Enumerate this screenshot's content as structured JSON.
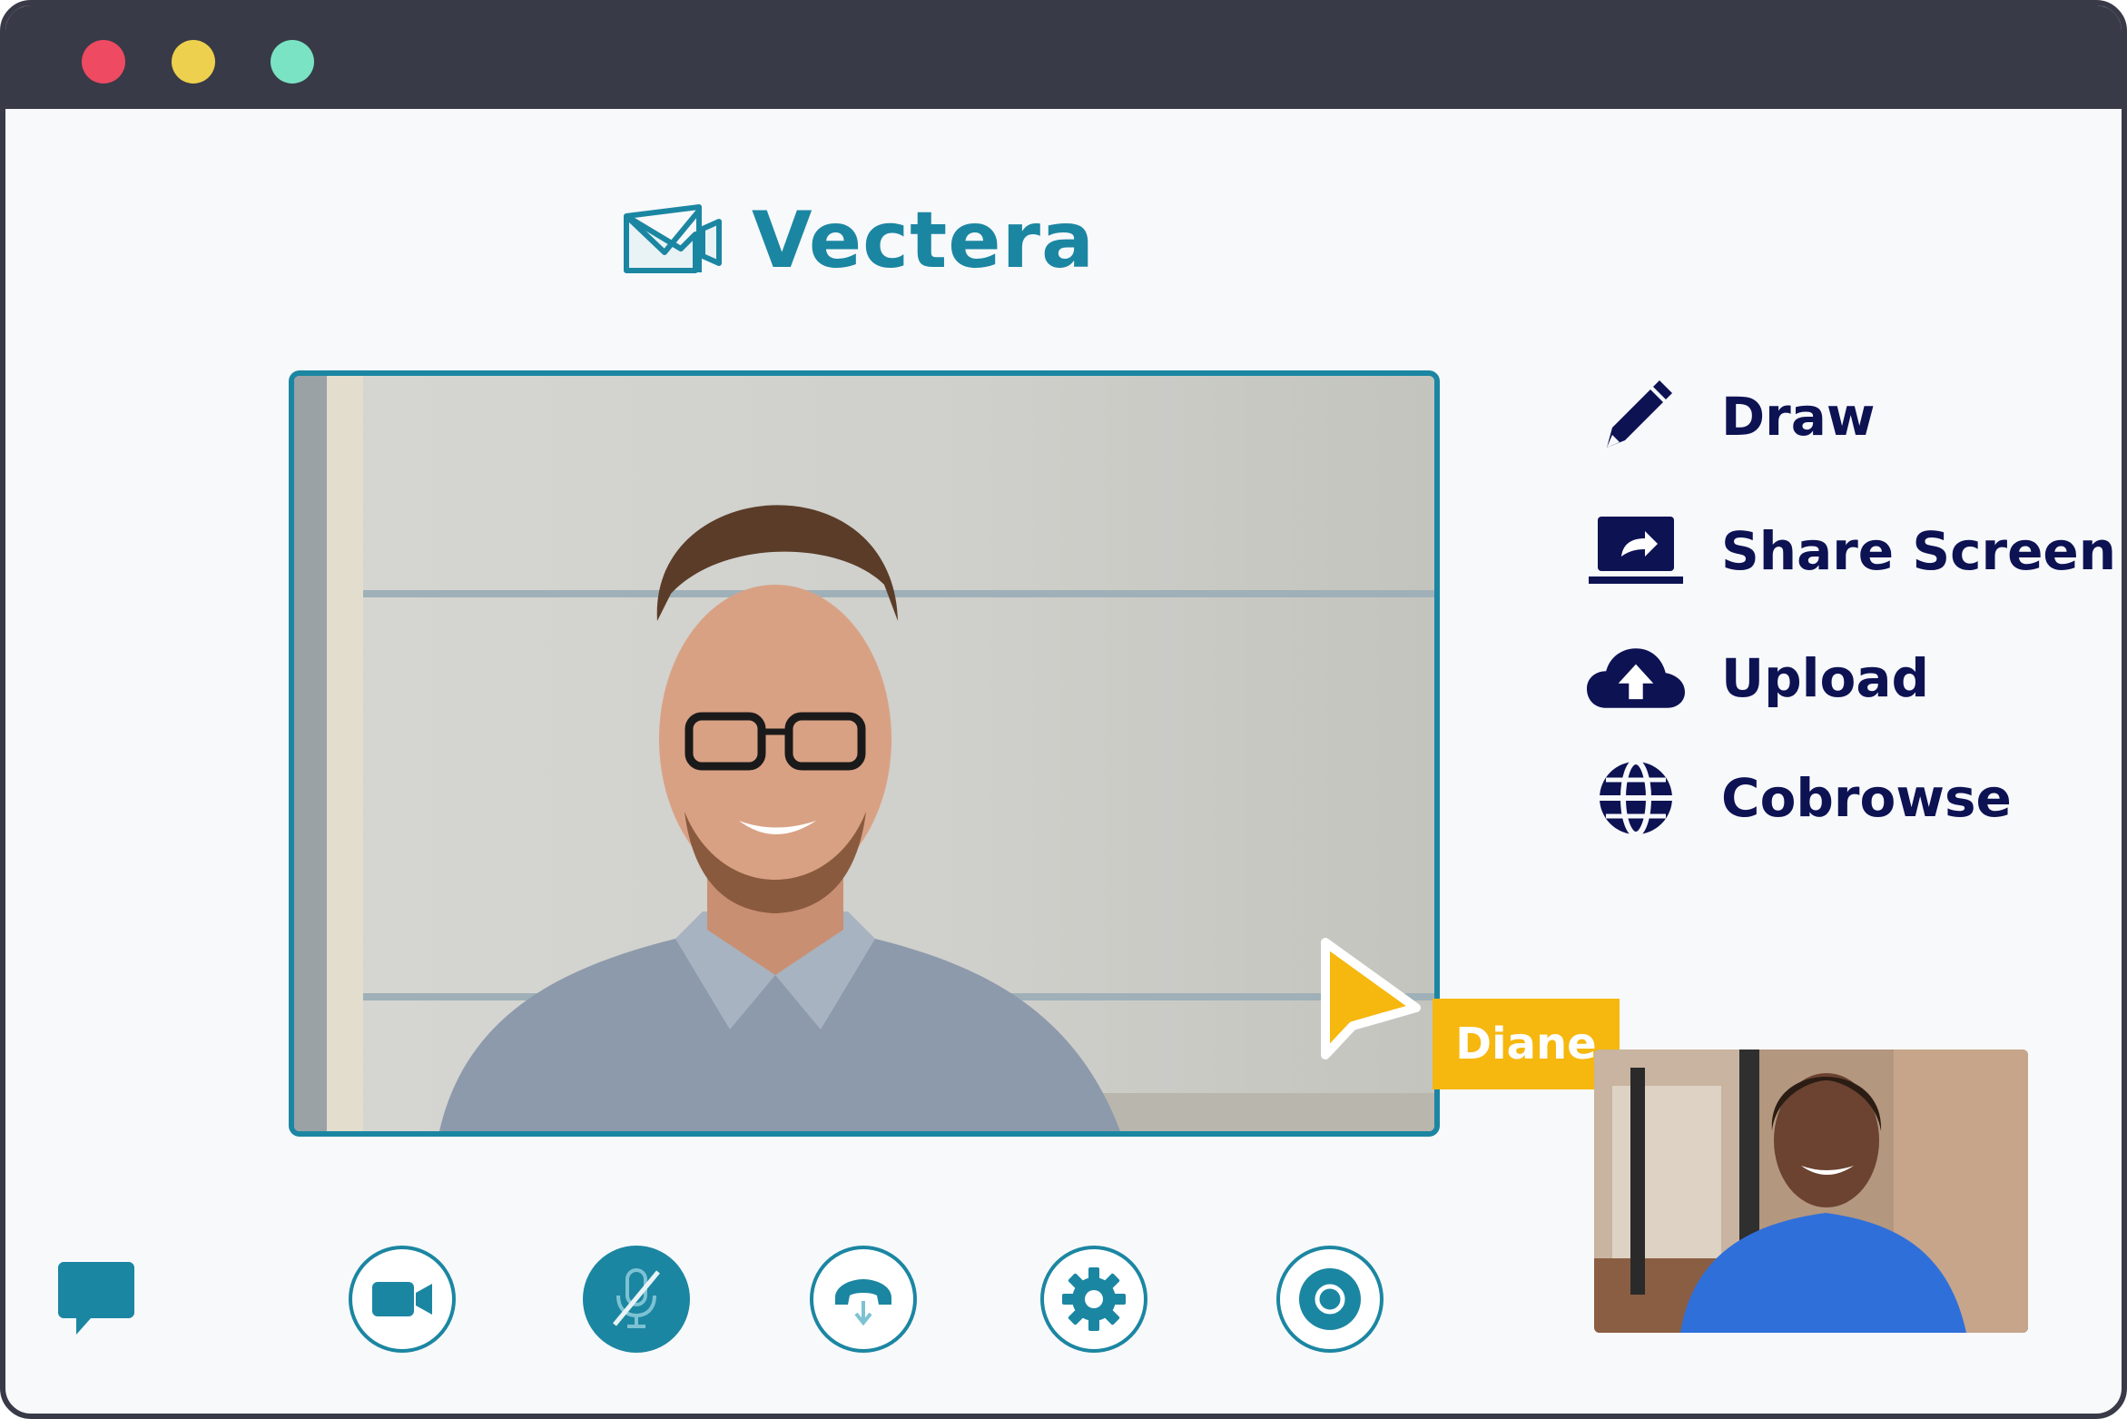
{
  "window": {
    "controls": [
      "close",
      "minimize",
      "maximize"
    ],
    "dot_colors": {
      "close": "#ee4a62",
      "minimize": "#edd04d",
      "maximize": "#7ae3c3"
    },
    "frame_color": "#383a47"
  },
  "brand": {
    "name": "Vectera",
    "color": "#1b86a2",
    "icon": "envelope-camera-logo"
  },
  "main_video": {
    "participant": "man-with-glasses",
    "border_color": "#1b86a2"
  },
  "pointer": {
    "label": "Diane",
    "color": "#f6b70f",
    "icon": "cursor-arrow-icon"
  },
  "thumbnail_video": {
    "participant": "woman-in-blue-shirt"
  },
  "tools": [
    {
      "label": "Draw",
      "icon": "pencil-icon"
    },
    {
      "label": "Share Screen",
      "icon": "laptop-share-icon"
    },
    {
      "label": "Upload",
      "icon": "cloud-upload-icon"
    },
    {
      "label": "Cobrowse",
      "icon": "globe-icon"
    }
  ],
  "tool_text_color": "#0d1253",
  "controls": [
    {
      "name": "camera",
      "icon": "video-camera-icon",
      "active": false
    },
    {
      "name": "microphone",
      "icon": "mic-muted-icon",
      "active": true
    },
    {
      "name": "hang-up",
      "icon": "phone-hangup-icon",
      "active": false
    },
    {
      "name": "settings",
      "icon": "gear-icon",
      "active": false
    },
    {
      "name": "record",
      "icon": "record-icon",
      "active": false
    }
  ],
  "chat": {
    "icon": "chat-bubble-icon"
  }
}
